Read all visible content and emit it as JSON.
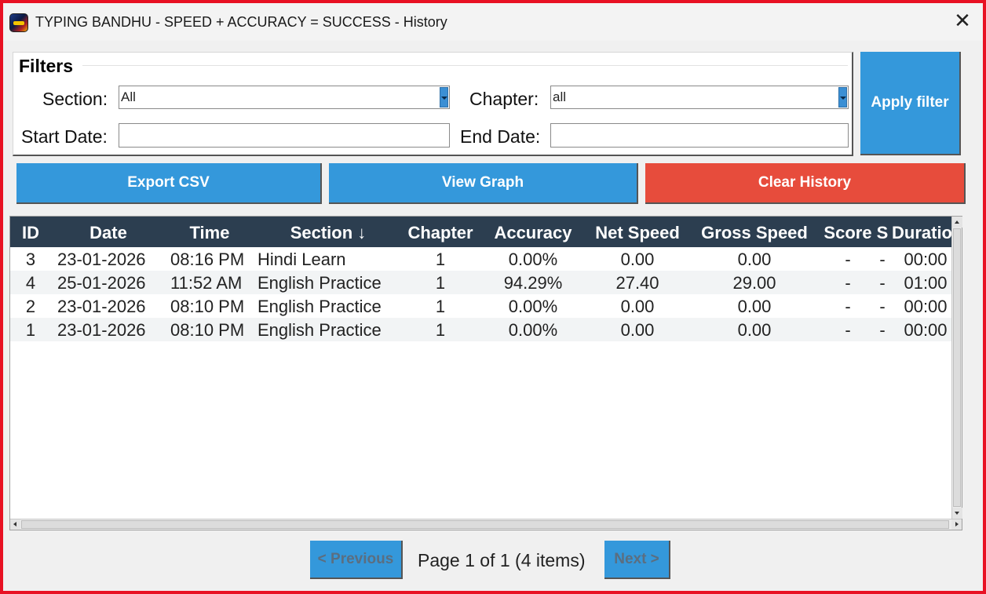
{
  "window": {
    "title": "TYPING BANDHU - SPEED + ACCURACY = SUCCESS - History",
    "close_label": "✕"
  },
  "filters": {
    "title": "Filters",
    "section_label": "Section:",
    "section_value": "All",
    "chapter_label": "Chapter:",
    "chapter_value": "all",
    "start_date_label": "Start Date:",
    "start_date_value": "",
    "end_date_label": "End Date:",
    "end_date_value": "",
    "apply_label": "Apply filter"
  },
  "actions": {
    "export_label": "Export CSV",
    "graph_label": "View Graph",
    "clear_label": "Clear History"
  },
  "colors": {
    "primary": "#3498db",
    "danger": "#e74c3c",
    "header_bg": "#2c3e50"
  },
  "table": {
    "columns": [
      "ID",
      "Date",
      "Time",
      "Section ↓",
      "Chapter",
      "Accuracy",
      "Net Speed",
      "Gross Speed",
      "Score",
      "S",
      "Duratio"
    ],
    "rows": [
      [
        "3",
        "23-01-2026",
        "08:16 PM",
        "Hindi Learn",
        "1",
        "0.00%",
        "0.00",
        "0.00",
        "-",
        "-",
        "00:00"
      ],
      [
        "4",
        "25-01-2026",
        "11:52 AM",
        "English Practice",
        "1",
        "94.29%",
        "27.40",
        "29.00",
        "-",
        "-",
        "01:00"
      ],
      [
        "2",
        "23-01-2026",
        "08:10 PM",
        "English Practice",
        "1",
        "0.00%",
        "0.00",
        "0.00",
        "-",
        "-",
        "00:00"
      ],
      [
        "1",
        "23-01-2026",
        "08:10 PM",
        "English Practice",
        "1",
        "0.00%",
        "0.00",
        "0.00",
        "-",
        "-",
        "00:00"
      ]
    ]
  },
  "pagination": {
    "previous_label": "< Previous",
    "page_info": "Page 1 of 1 (4 items)",
    "next_label": "Next >"
  }
}
